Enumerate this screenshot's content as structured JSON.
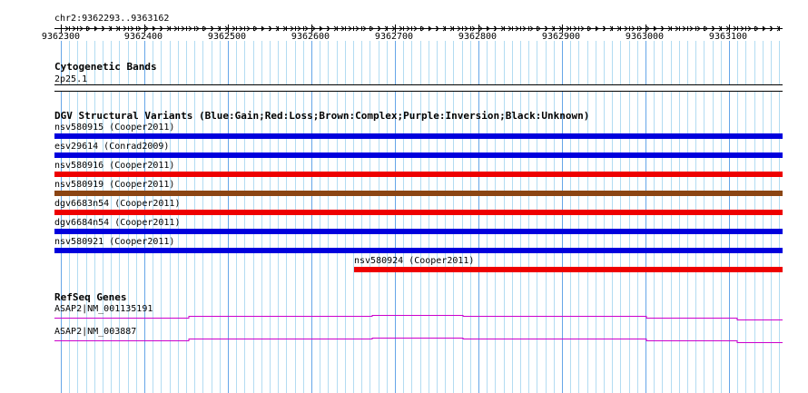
{
  "ruler": {
    "range_label": "chr2:9362293..9363162",
    "ticks": [
      "9362300",
      "9362400",
      "9362500",
      "9362600",
      "9362700",
      "9362800",
      "9362900",
      "9363000",
      "9363100"
    ]
  },
  "tracks": {
    "cytoband": {
      "title": "Cytogenetic Bands",
      "band_label": "2p25.1"
    },
    "dgv": {
      "title": "DGV Structural Variants (Blue:Gain;Red:Loss;Brown:Complex;Purple:Inversion;Black:Unknown)",
      "legend_colors": {
        "gain": "#0000dd",
        "loss": "#ee0000",
        "complex": "#8b4513",
        "inversion": "#800080",
        "unknown": "#000000"
      },
      "variants": [
        {
          "label": "nsv580915 (Cooper2011)",
          "type": "gain",
          "color": "#0000dd"
        },
        {
          "label": "esv29614 (Conrad2009)",
          "type": "gain",
          "color": "#0000dd"
        },
        {
          "label": "nsv580916 (Cooper2011)",
          "type": "loss",
          "color": "#ee0000"
        },
        {
          "label": "nsv580919 (Cooper2011)",
          "type": "complex",
          "color": "#8b4513"
        },
        {
          "label": "dgv6683n54 (Cooper2011)",
          "type": "loss",
          "color": "#ee0000"
        },
        {
          "label": "dgv6684n54 (Cooper2011)",
          "type": "gain",
          "color": "#0000dd"
        },
        {
          "label": "nsv580921 (Cooper2011)",
          "type": "gain",
          "color": "#0000dd"
        },
        {
          "label": "nsv580924 (Cooper2011)",
          "type": "loss",
          "color": "#ee0000"
        }
      ]
    },
    "refseq": {
      "title": "RefSeq Genes",
      "line_color": "#cc00cc",
      "genes": [
        {
          "label": "ASAP2|NM_001135191"
        },
        {
          "label": "ASAP2|NM_003887"
        }
      ]
    }
  }
}
